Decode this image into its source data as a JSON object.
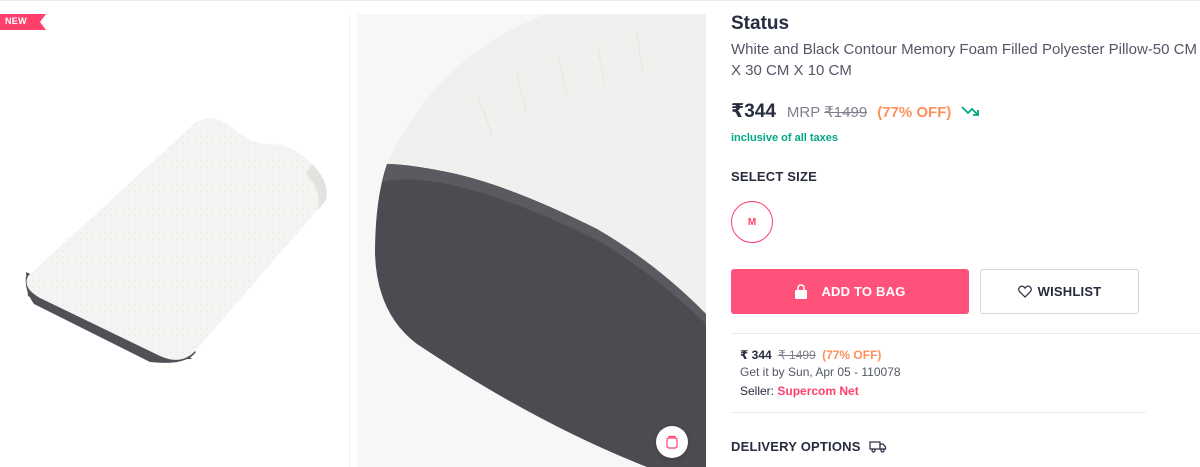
{
  "badges": {
    "new": "NEW"
  },
  "product": {
    "brand": "Status",
    "title": "White and Black Contour Memory Foam Filled Polyester Pillow-50 CM X 30 CM X 10 CM"
  },
  "pricing": {
    "price": "₹344",
    "mrp_label": "MRP",
    "mrp_value": "₹1499",
    "discount": "(77% OFF)",
    "tax_note": "inclusive of all taxes"
  },
  "size": {
    "heading": "SELECT SIZE",
    "options": [
      "M"
    ]
  },
  "actions": {
    "add_to_bag": "ADD TO BAG",
    "wishlist": "WISHLIST"
  },
  "offer": {
    "price": "₹ 344",
    "mrp": "₹ 1499",
    "discount": "(77% OFF)",
    "eta": "Get it by Sun, Apr 05 - 110078",
    "seller_label": "Seller:",
    "seller_name": "Supercom Net"
  },
  "delivery": {
    "heading": "DELIVERY OPTIONS"
  },
  "icons": {
    "trend": "trending-down-icon",
    "bag": "bag-icon",
    "heart": "heart-icon",
    "truck": "truck-icon",
    "similar": "similar-products-icon"
  },
  "colors": {
    "accent": "#ff3f6c",
    "button": "#ff527b",
    "discount": "#ff905a",
    "tax": "#03a685"
  }
}
